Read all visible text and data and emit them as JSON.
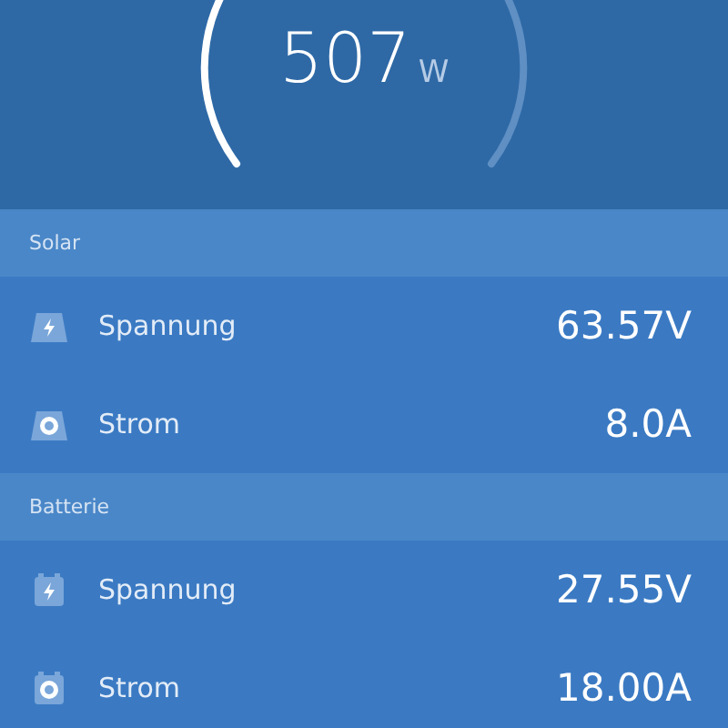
{
  "gauge": {
    "value": "507",
    "unit": "W"
  },
  "sections": [
    {
      "title": "Solar",
      "rows": [
        {
          "kind": "solar-voltage",
          "label": "Spannung",
          "value": "63.57V"
        },
        {
          "kind": "solar-current",
          "label": "Strom",
          "value": "8.0A"
        }
      ]
    },
    {
      "title": "Batterie",
      "rows": [
        {
          "kind": "battery-voltage",
          "label": "Spannung",
          "value": "27.55V"
        },
        {
          "kind": "battery-current",
          "label": "Strom",
          "value": "18.00A"
        }
      ]
    }
  ]
}
